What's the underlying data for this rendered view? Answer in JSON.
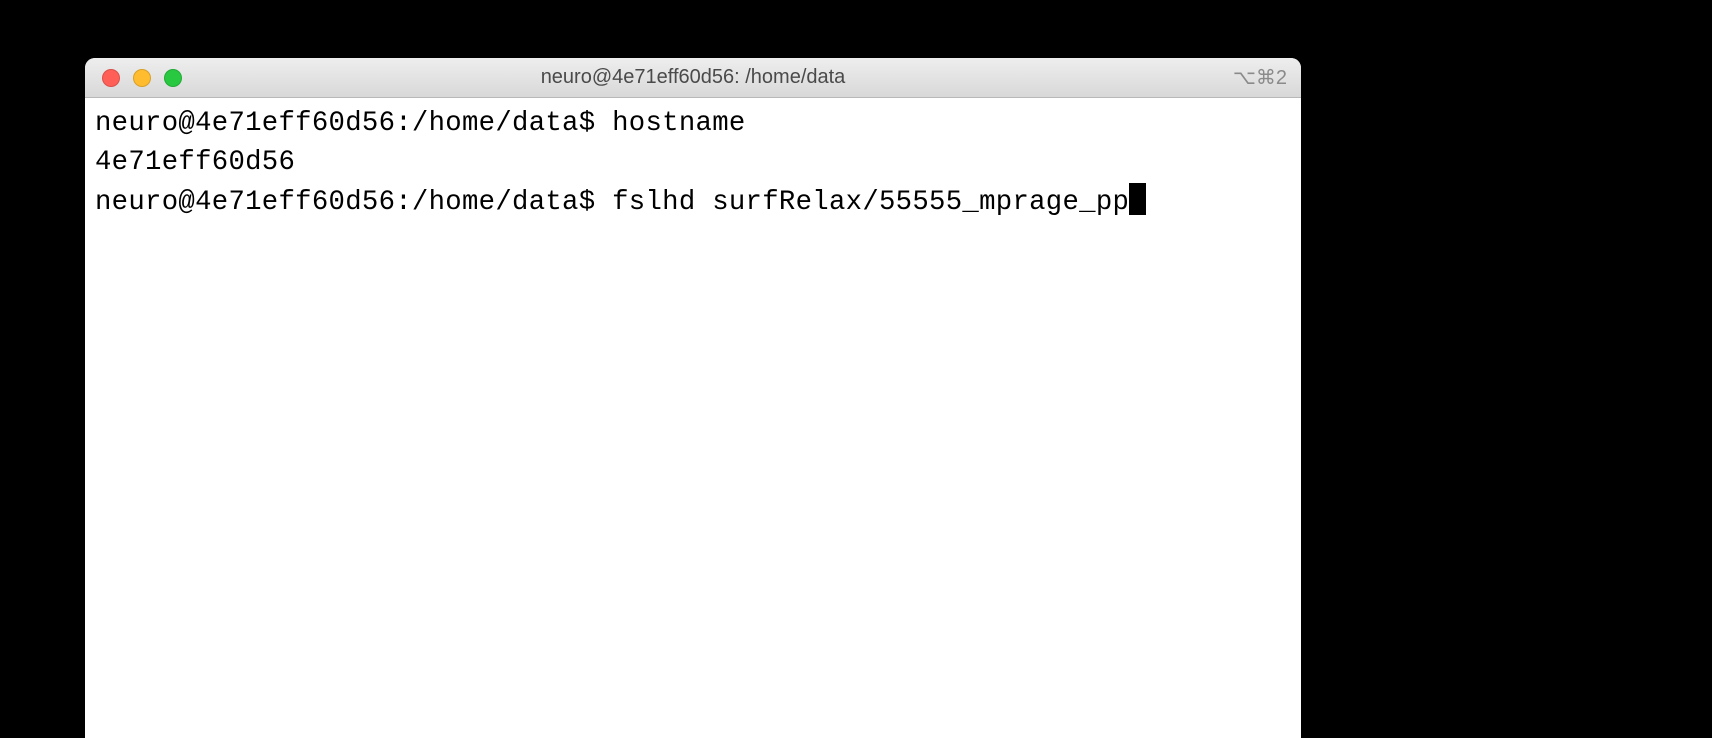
{
  "window": {
    "title": "neuro@4e71eff60d56: /home/data",
    "shortcut": "⌥⌘2"
  },
  "terminal": {
    "lines": [
      {
        "prompt": "neuro@4e71eff60d56:/home/data$ ",
        "command": "hostname"
      },
      {
        "output": "4e71eff60d56"
      },
      {
        "prompt": "neuro@4e71eff60d56:/home/data$ ",
        "command": "fslhd surfRelax/55555_mprage_pp",
        "cursor": true
      }
    ]
  }
}
